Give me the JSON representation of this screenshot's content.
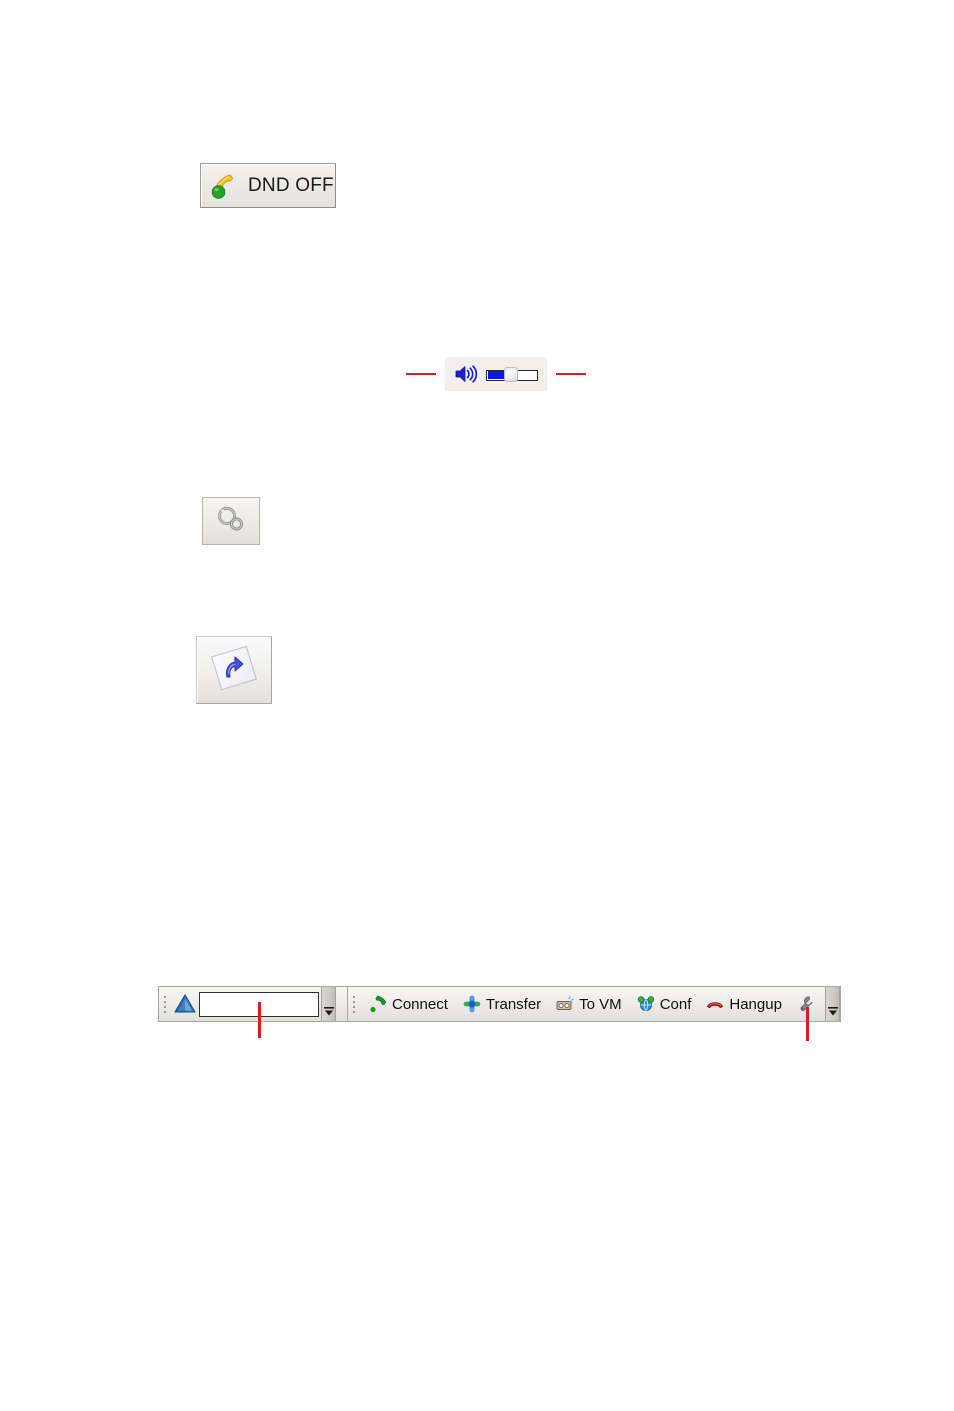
{
  "document": {
    "page_background": "#ffffff"
  },
  "dnd_button": {
    "label": "DND OFF",
    "icon": "phone-handset-green-dot-icon",
    "state": "off",
    "background": "#eeece8",
    "border_color": "#9d9d9d",
    "icon_color": "#e8c21e",
    "indicator_color": "#2ca02c"
  },
  "volume_control": {
    "speaker_icon": "speaker-volume-icon",
    "speaker_color": "#1818c8",
    "slider": {
      "name": "volume-slider",
      "value": 33,
      "min": 0,
      "max": 100,
      "fill_color": "#0a18e0",
      "track_color": "#ffffff",
      "track_border": "#2a2a2a"
    },
    "annotation_color": "#e01b1b",
    "annotation_left": "callout-line-left",
    "annotation_right": "callout-line-right"
  },
  "circles_button": {
    "icon": "two-rings-settings-icon",
    "label": "",
    "background": "#ebe9e6",
    "border_color": "#b6b4b1"
  },
  "forward_button": {
    "icon": "call-forward-arrow-page-icon",
    "label": "",
    "background": "#f0efed",
    "border_color": "#a8a6a3",
    "arrow_color": "#3a45cf"
  },
  "toolbar": {
    "dial_group": {
      "grip": "drag-grip",
      "app_icon": "blue-triangle-app-icon",
      "app_icon_color": "#2b6fb5",
      "dial_input": {
        "value": "",
        "placeholder": ""
      },
      "overflow_icon": "toolbar-overflow-chevron"
    },
    "actions_group": {
      "grip": "drag-grip",
      "items": [
        {
          "label": "Connect",
          "icon": "green-phone-handset-icon",
          "color": "#1a8f2e"
        },
        {
          "label": "Transfer",
          "icon": "transfer-nodes-icon",
          "color": "#2e7bd6"
        },
        {
          "label": "To VM",
          "icon": "voicemail-tape-icon",
          "color": "#7a6a55"
        },
        {
          "label": "Conf",
          "icon": "conference-globe-icon",
          "color": "#2b8fd0"
        },
        {
          "label": "Hangup",
          "icon": "red-phone-hangup-icon",
          "color": "#cc1111"
        }
      ],
      "settings_icon": "wrench-settings-icon",
      "settings_color": "#6e6e78",
      "overflow_icon": "toolbar-overflow-chevron"
    },
    "annotations": [
      {
        "name": "dial-field-callout",
        "color": "#e01b1b"
      },
      {
        "name": "wrench-button-callout",
        "color": "#e01b1b"
      }
    ]
  }
}
